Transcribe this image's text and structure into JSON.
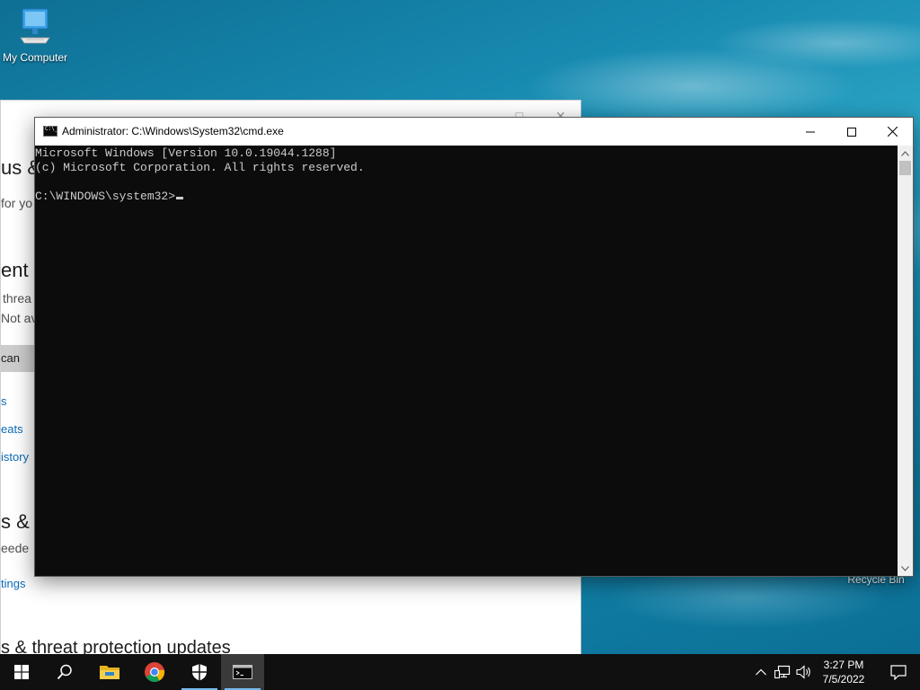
{
  "desktop": {
    "icons": [
      {
        "label": "My Computer"
      },
      {
        "label": "Recycle Bin"
      }
    ]
  },
  "security_window": {
    "heading_1": "us &",
    "subtitle_1": "for yo",
    "heading_2": "ent t",
    "line_1": "threa",
    "line_2": "Not av",
    "button": "can",
    "link_1": "s",
    "link_2": "eats",
    "link_3": "istory",
    "heading_3": "s & t",
    "line_3": "eede",
    "link_4": "tings",
    "heading_4": "s & threat protection updates"
  },
  "cmd_window": {
    "title": "Administrator: C:\\Windows\\System32\\cmd.exe",
    "lines": [
      "Microsoft Windows [Version 10.0.19044.1288]",
      "(c) Microsoft Corporation. All rights reserved.",
      "",
      "C:\\WINDOWS\\system32>"
    ]
  },
  "taskbar": {
    "apps": [
      {
        "icon": "windows-start-icon"
      },
      {
        "icon": "search-icon"
      },
      {
        "icon": "file-explorer-icon"
      },
      {
        "icon": "chrome-icon"
      },
      {
        "icon": "windows-security-icon"
      },
      {
        "icon": "cmd-icon"
      }
    ],
    "clock": {
      "time": "3:27 PM",
      "date": "7/5/2022"
    }
  },
  "colors": {
    "console_bg": "#0c0c0c",
    "console_text": "#cccccc",
    "link": "#0a6bb8",
    "taskbar": "#101010",
    "running_indicator": "#76b9ed"
  }
}
